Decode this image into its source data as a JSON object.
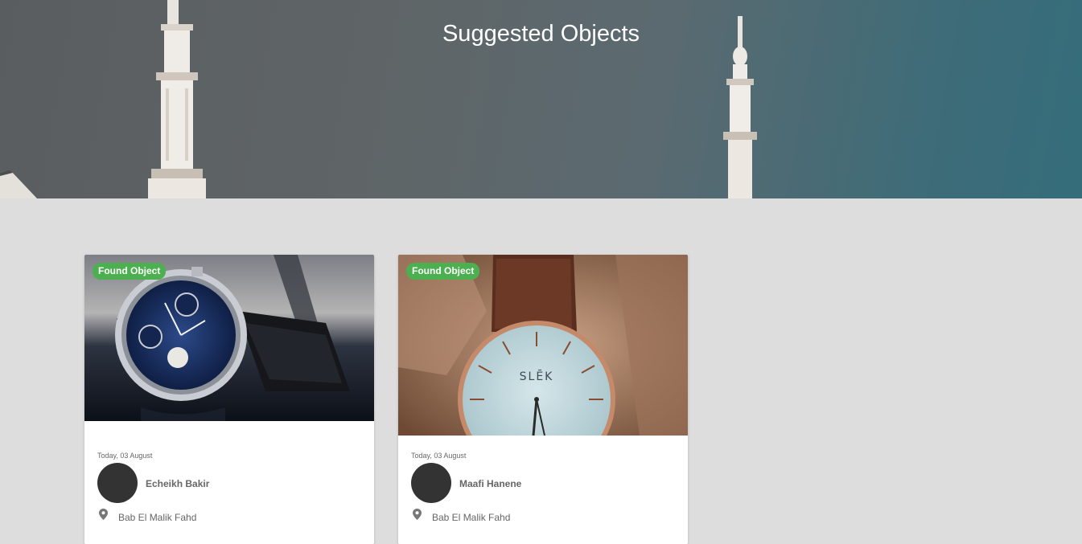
{
  "header": {
    "title": "Suggested Objects"
  },
  "cards": [
    {
      "badge": "Found Object",
      "date": "Today, 03 August",
      "author": "Echeikh Bakir",
      "location": "Bab El Malik Fahd",
      "image_icon": "wristwatch-blue-dial-icon"
    },
    {
      "badge": "Found Object",
      "date": "Today, 03 August",
      "author": "Maafi Hanene",
      "location": "Bab El Malik Fahd",
      "image_icon": "wristwatch-white-dial-icon",
      "watch_brand": "SLĒK"
    }
  ],
  "colors": {
    "badge": "#4caf50",
    "page_background": "#dddddd",
    "avatar": "#333333"
  }
}
